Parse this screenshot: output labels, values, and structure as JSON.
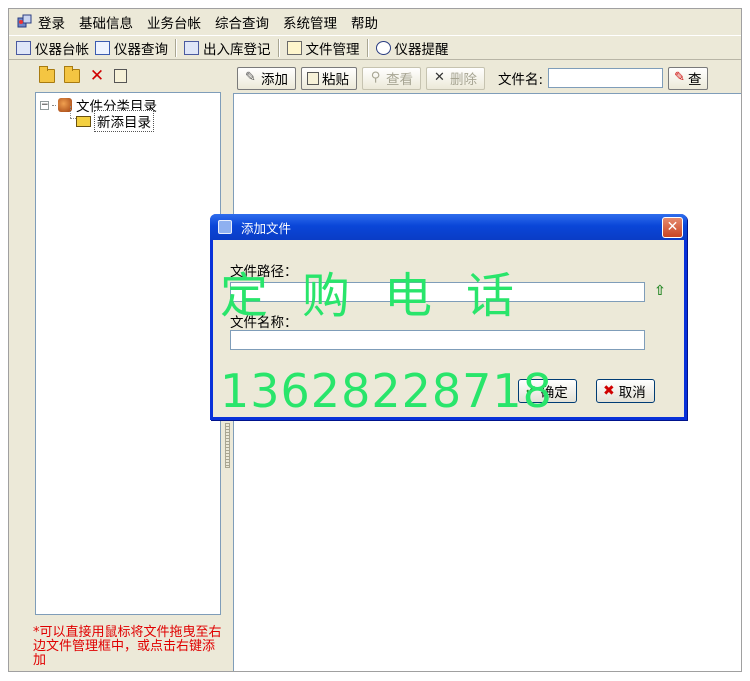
{
  "menu": {
    "items": [
      {
        "label": "登录",
        "icon": "app-login-icon"
      },
      {
        "label": "基础信息"
      },
      {
        "label": "业务台帐"
      },
      {
        "label": "综合查询"
      },
      {
        "label": "系统管理"
      },
      {
        "label": "帮助"
      }
    ]
  },
  "toolbar": {
    "items": [
      {
        "label": "仪器台帐",
        "icon": "ledger-icon"
      },
      {
        "label": "仪器查询",
        "icon": "query-icon"
      },
      {
        "label": "出入库登记",
        "icon": "inout-icon"
      },
      {
        "label": "文件管理",
        "icon": "file-manage-icon"
      },
      {
        "label": "仪器提醒",
        "icon": "reminder-icon"
      }
    ]
  },
  "tree": {
    "root_label": "文件分类目录",
    "child_label": "新添目录",
    "expander": "−"
  },
  "left_hint": "*可以直接用鼠标将文件拖曳至右边文件管理框中，或点击右键添加",
  "file_toolbar": {
    "add_label": "添加",
    "paste_label": "粘贴",
    "view_label": "查看",
    "delete_label": "删除",
    "filename_label": "文件名:",
    "filename_value": "",
    "search_label": "查"
  },
  "dialog": {
    "title": "添加文件",
    "path_label": "文件路径：",
    "path_value": "",
    "name_label": "文件名称：",
    "name_value": "",
    "ok_label": "确定",
    "cancel_label": "取消",
    "close_glyph": "✕"
  },
  "watermark": {
    "text": "定购电话",
    "phone": "13628228718",
    "color": "#29e56b"
  }
}
